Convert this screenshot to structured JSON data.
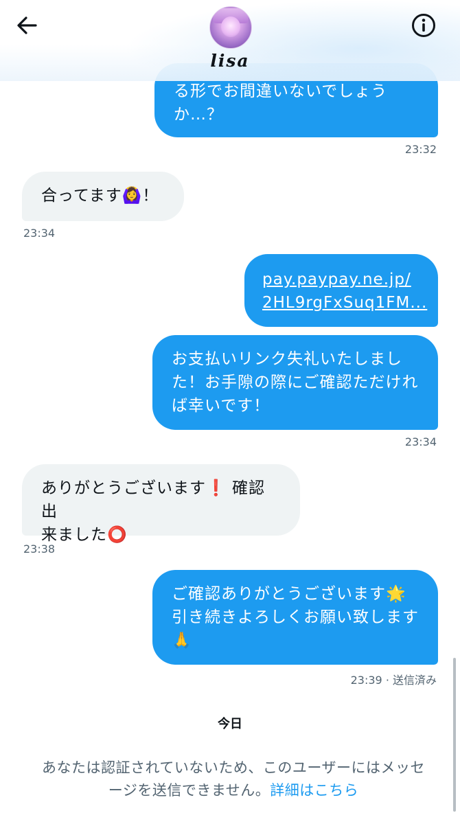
{
  "header": {
    "username": "lisa"
  },
  "messages": [
    {
      "text_lines": [
        "る形でお間違いないでしょう",
        "か…？"
      ],
      "time": "23:32"
    },
    {
      "text": "合ってます🙆‍♀️！",
      "time": "23:34"
    },
    {
      "link_lines": [
        "pay.paypay.ne.jp/",
        "2HL9rgFxSuq1FM..."
      ]
    },
    {
      "text_lines": [
        "お支払いリンク失礼いたしまし",
        "た！お手隙の際にご確認ただけれ",
        "ば幸いです！"
      ],
      "time": "23:34"
    },
    {
      "text_lines": [
        "ありがとうございます❗️ 確認出",
        "来ました⭕️"
      ],
      "time": "23:38"
    },
    {
      "text_lines": [
        "ご確認ありがとうございます🌟",
        "引き続きよろしくお願い致します",
        "🙏"
      ],
      "time": "23:39",
      "status": " · 送信済み"
    }
  ],
  "date_divider": "今日",
  "notice": {
    "line1": "あなたは認証されていないため、このユーザーにはメッセ",
    "line2": "ージを送信できません。",
    "link": "詳細はこちら"
  },
  "colors": {
    "outgoing_bubble": "#1d9bf0",
    "incoming_bubble": "#eff3f4",
    "link": "#1d9bf0",
    "muted_text": "#536471"
  },
  "icons": {
    "back": "arrow-left-icon",
    "info": "info-circle-icon"
  }
}
